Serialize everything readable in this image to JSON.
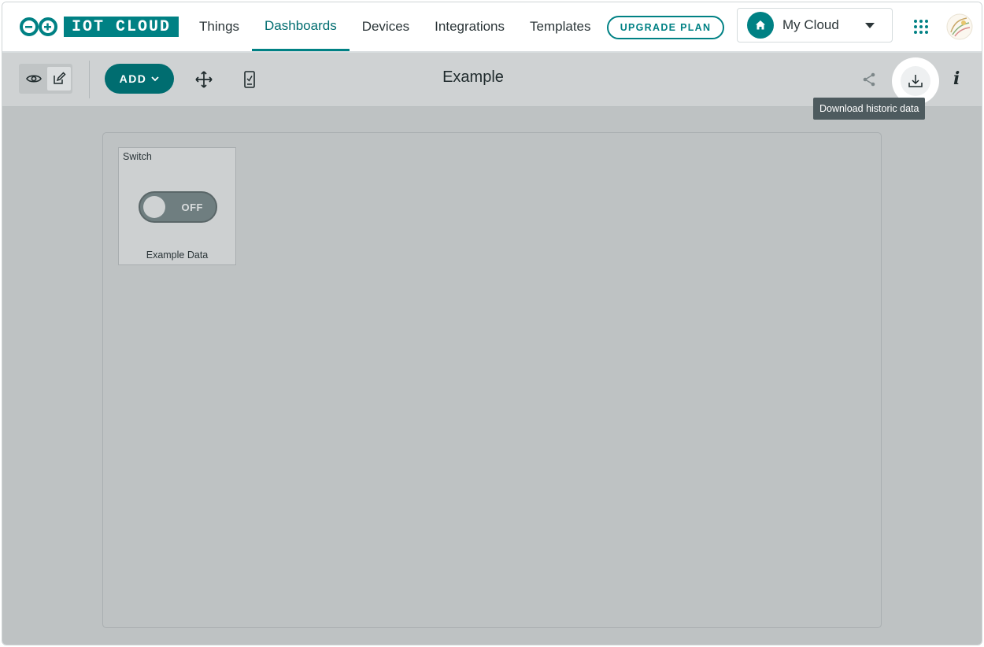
{
  "brand": {
    "logo_text": "IOT CLOUD",
    "accent_color": "#008184"
  },
  "nav": {
    "items": [
      {
        "label": "Things"
      },
      {
        "label": "Dashboards",
        "active": true
      },
      {
        "label": "Devices"
      },
      {
        "label": "Integrations"
      },
      {
        "label": "Templates"
      }
    ],
    "upgrade_label": "UPGRADE PLAN"
  },
  "space": {
    "name": "My Cloud",
    "icon": "home-icon"
  },
  "toolbar": {
    "view_icon": "eye-icon",
    "edit_icon": "edit-icon",
    "add_label": "ADD",
    "move_icon": "move-icon",
    "mobile_icon": "mobile-icon",
    "dashboard_title": "Example",
    "share_icon": "share-icon",
    "download_icon": "download-icon",
    "info_label": "i"
  },
  "tooltip": {
    "text": "Download historic data"
  },
  "widget": {
    "title": "Switch",
    "state_label": "OFF",
    "caption": "Example Data"
  }
}
